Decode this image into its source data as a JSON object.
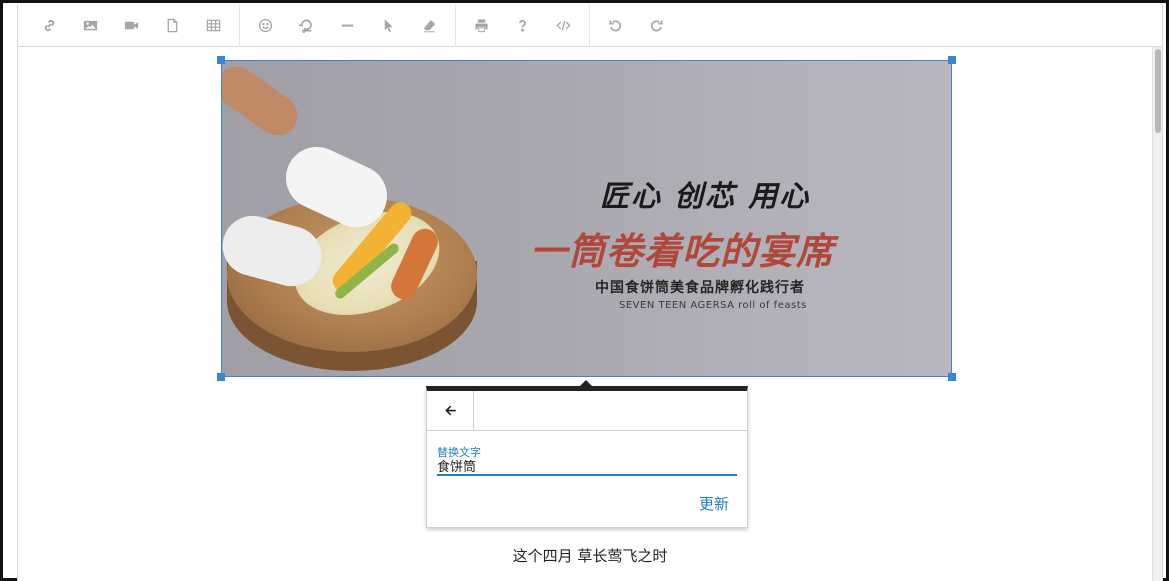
{
  "toolbar": {
    "groups": [
      [
        "link-icon",
        "image-icon",
        "video-icon",
        "file-icon",
        "table-icon"
      ],
      [
        "emoticon-icon",
        "omega-icon",
        "horizontal-rule-icon",
        "select-all-icon",
        "clear-formatting-icon"
      ],
      [
        "print-icon",
        "help-icon",
        "code-view-icon"
      ],
      [
        "undo-icon",
        "redo-icon"
      ]
    ]
  },
  "image": {
    "line1": "匠心 创芯 用心",
    "line2": "一筒卷着吃的宴席",
    "line3": "中国食饼筒美食品牌孵化践行者",
    "line4": "SEVEN TEEN AGERSA roll of feasts"
  },
  "alt_popup": {
    "label": "替换文字",
    "value": "食饼筒",
    "update_label": "更新"
  },
  "caption": "这个四月 草长莺飞之时",
  "colors": {
    "accent": "#1f7fc2",
    "selection": "#3a86d0",
    "headline_red": "#b0473a"
  }
}
